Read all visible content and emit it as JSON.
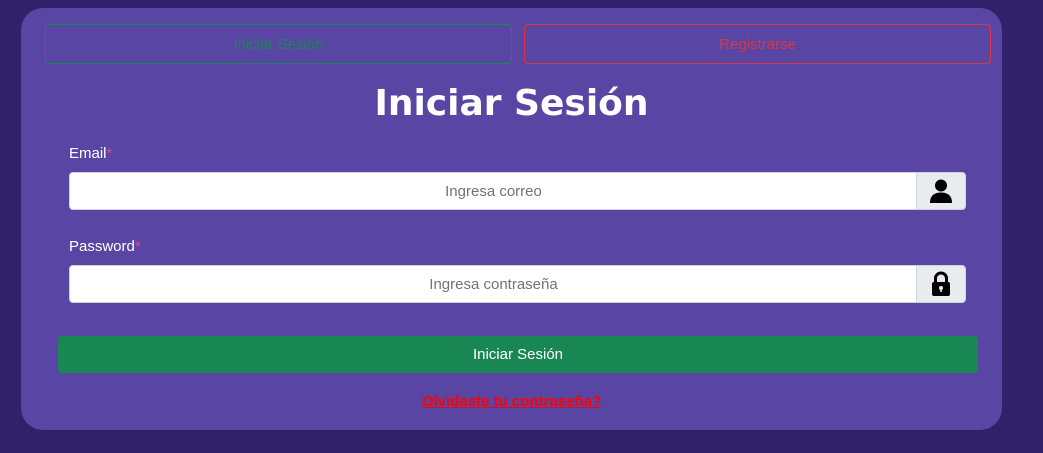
{
  "tabs": {
    "login_label": "Iniciar Sesión",
    "register_label": "Registrarse"
  },
  "title": "Iniciar Sesión",
  "email": {
    "label": "Email",
    "required_mark": "*",
    "placeholder": "Ingresa correo",
    "value": "",
    "icon": "user-icon"
  },
  "password": {
    "label": "Password",
    "required_mark": "*",
    "placeholder": "Ingresa contraseña",
    "value": "",
    "icon": "lock-icon"
  },
  "submit_label": "Iniciar Sesión",
  "forgot_label": "Olvidaste tu contraseña?",
  "colors": {
    "page_background": "#31206a",
    "card_background": "#5945a3",
    "success": "#198754",
    "danger": "#dc3545",
    "link": "#ff0000"
  }
}
